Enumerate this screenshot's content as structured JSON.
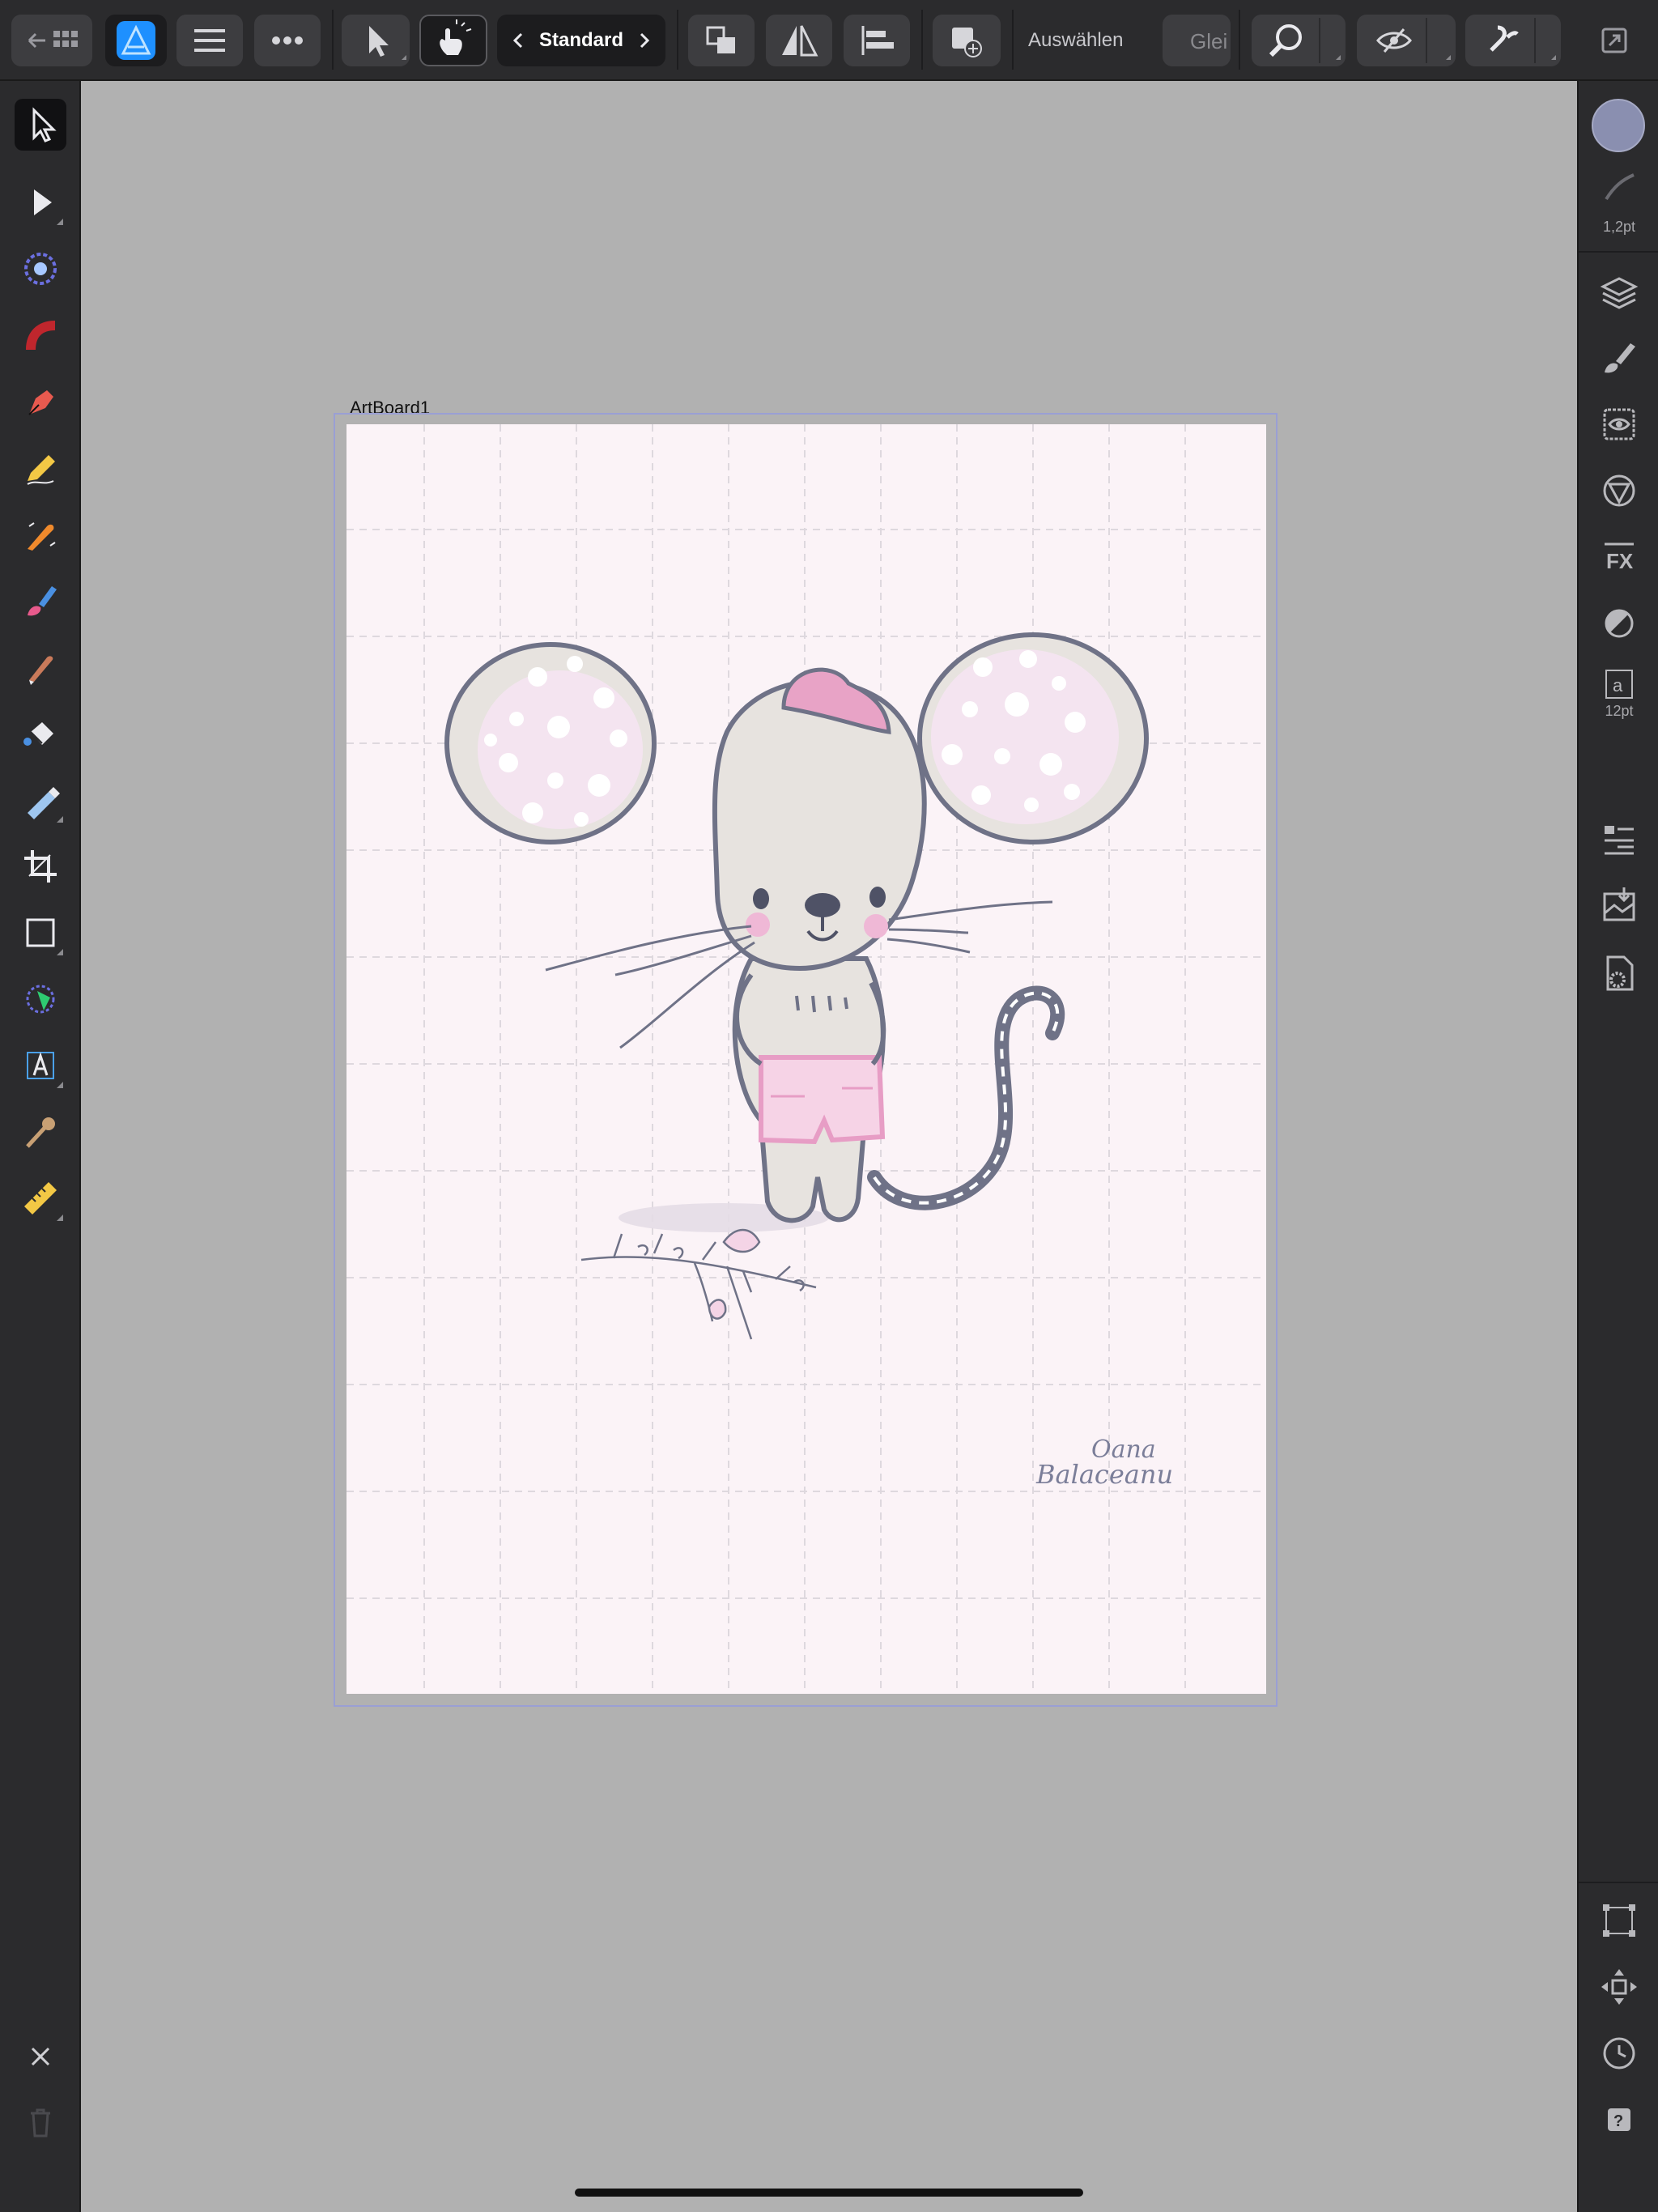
{
  "app": {
    "name": "Affinity Designer"
  },
  "toolbar": {
    "persona_label": "Standard",
    "select_label": "Auswählen",
    "snap_mode_label": "Glei"
  },
  "stroke": {
    "width_label": "1,2pt",
    "color": "#8a8fb0"
  },
  "text_size_label": "12pt",
  "artboard": {
    "label": "ArtBoard1"
  },
  "artwork": {
    "signature_line1": "Oana",
    "signature_line2": "Balaceanu"
  },
  "colors": {
    "background": "#b1b1b1",
    "panel": "#2b2b2d",
    "accent_blue": "#1e90ff",
    "canvas": "#fbf3f7",
    "ear_pink": "#f4e4f0",
    "shorts_pink": "#efb8d6"
  },
  "icons": {
    "left_tools": [
      "move-tool-icon",
      "node-tool-icon",
      "corner-tool-icon",
      "fill-tool-icon",
      "pen-tool-icon",
      "pencil-tool-icon",
      "vector-brush-icon",
      "brush-tool-icon",
      "knife-tool-icon",
      "fill-bucket-icon",
      "transparency-tool-icon",
      "crop-tool-icon",
      "rectangle-tool-icon",
      "shape-tool-icon",
      "text-tool-icon",
      "color-picker-icon",
      "measure-tool-icon"
    ],
    "right_studios": [
      "layers-icon",
      "brushes-icon",
      "appearance-icon",
      "stroke-icon",
      "fx-icon",
      "color-icon",
      "text-style-icon",
      "character-icon",
      "export-icon",
      "settings-icon"
    ]
  }
}
